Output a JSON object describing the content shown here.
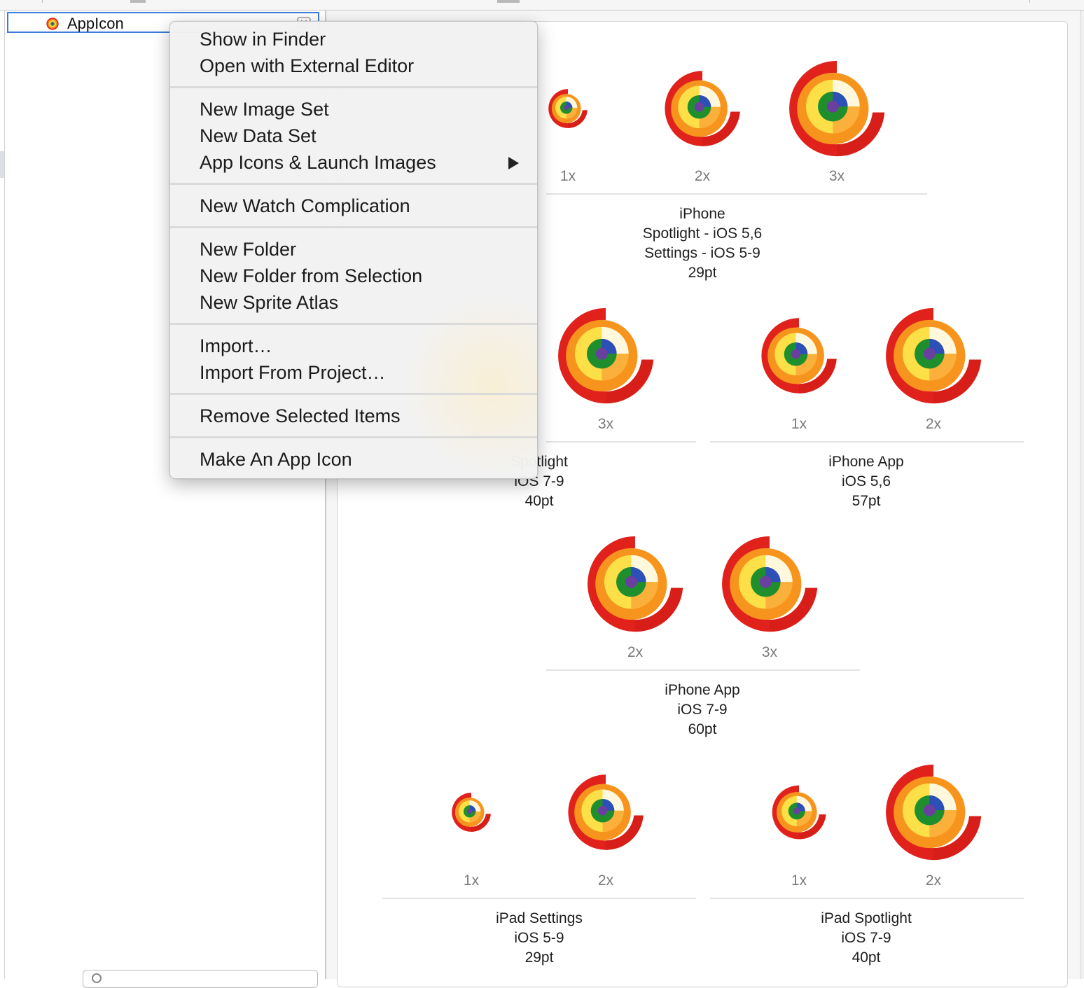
{
  "navigator": {
    "selected_item": {
      "label": "AppIcon",
      "icon": "app-icon-thumbnail"
    },
    "row_accessory_icon": "close-icon",
    "filter_icon": "search-icon"
  },
  "context_menu": {
    "sections": [
      {
        "items": [
          {
            "label": "Show in Finder"
          },
          {
            "label": "Open with External Editor"
          }
        ]
      },
      {
        "items": [
          {
            "label": "New Image Set"
          },
          {
            "label": "New Data Set"
          },
          {
            "label": "App Icons & Launch Images",
            "submenu": true
          }
        ]
      },
      {
        "items": [
          {
            "label": "New Watch Complication"
          }
        ]
      },
      {
        "items": [
          {
            "label": "New Folder"
          },
          {
            "label": "New Folder from Selection"
          },
          {
            "label": "New Sprite Atlas"
          }
        ]
      },
      {
        "items": [
          {
            "label": "Import…"
          },
          {
            "label": "Import From Project…"
          }
        ]
      },
      {
        "items": [
          {
            "label": "Remove Selected Items"
          }
        ]
      },
      {
        "items": [
          {
            "label": "Make An App Icon"
          }
        ]
      }
    ]
  },
  "icon_groups": [
    {
      "title_lines": [
        "iPhone",
        "Spotlight - iOS 5,6",
        "Settings - iOS 5-9",
        "29pt"
      ],
      "scales": [
        "1x",
        "2x",
        "3x"
      ]
    },
    {
      "title_lines": [
        "Spotlight",
        "iOS 7-9",
        "40pt"
      ],
      "scales": [
        "3x"
      ]
    },
    {
      "title_lines": [
        "iPhone App",
        "iOS 5,6",
        "57pt"
      ],
      "scales": [
        "1x",
        "2x"
      ]
    },
    {
      "title_lines": [
        "iPhone App",
        "iOS 7-9",
        "60pt"
      ],
      "scales": [
        "2x",
        "3x"
      ]
    },
    {
      "title_lines": [
        "iPad Settings",
        "iOS 5-9",
        "29pt"
      ],
      "scales": [
        "1x",
        "2x"
      ]
    },
    {
      "title_lines": [
        "iPad Spotlight",
        "iOS 7-9",
        "40pt"
      ],
      "scales": [
        "1x",
        "2x"
      ]
    }
  ],
  "icon_colors": {
    "outer_red": "#e0211c",
    "orange": "#f7941d",
    "yellow": "#fde047",
    "cream": "#fff8dc",
    "green": "#1f8f2e",
    "blue": "#2d4fb8",
    "purple": "#6a3fa0"
  }
}
